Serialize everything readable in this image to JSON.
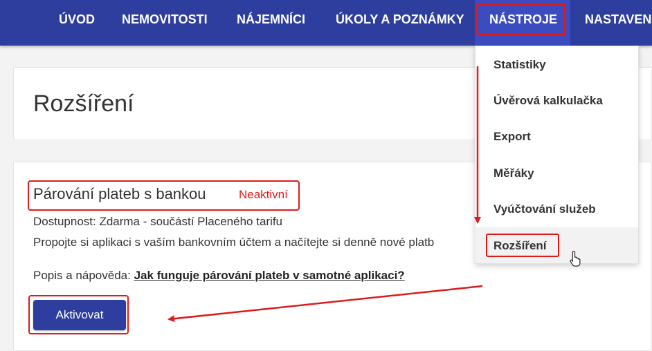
{
  "nav": {
    "items": [
      {
        "label": "ÚVOD"
      },
      {
        "label": "NEMOVITOSTI"
      },
      {
        "label": "NÁJEMNÍCI"
      },
      {
        "label": "ÚKOLY A POZNÁMKY"
      },
      {
        "label": "NÁSTROJE",
        "active": true
      },
      {
        "label": "NASTAVEN"
      }
    ]
  },
  "page": {
    "title": "Rozšíření"
  },
  "feature": {
    "title": "Párování plateb s bankou",
    "status": "Neaktivní",
    "availability": "Dostupnost: Zdarma - součástí Placeného tarifu",
    "description": "Propojte si aplikaci s vaším bankovním účtem a načítejte si denně nové platb",
    "help_prefix": "Popis a nápověda: ",
    "help_link": "Jak funguje párování plateb v samotné aplikaci?",
    "activate_label": "Aktivovat"
  },
  "dropdown": {
    "items": [
      {
        "label": "Statistiky"
      },
      {
        "label": "Úvěrová kalkulačka"
      },
      {
        "label": "Export"
      },
      {
        "label": "Měřáky"
      },
      {
        "label": "Vyúčtování služeb"
      },
      {
        "label": "Rozšíření",
        "hovered": true
      }
    ]
  },
  "colors": {
    "nav_bg": "#2e3e9e",
    "nav_active": "#3b4cc0",
    "highlight": "#e01a1a",
    "status_inactive": "#e01a1a",
    "button_bg": "#2e3e9e"
  }
}
